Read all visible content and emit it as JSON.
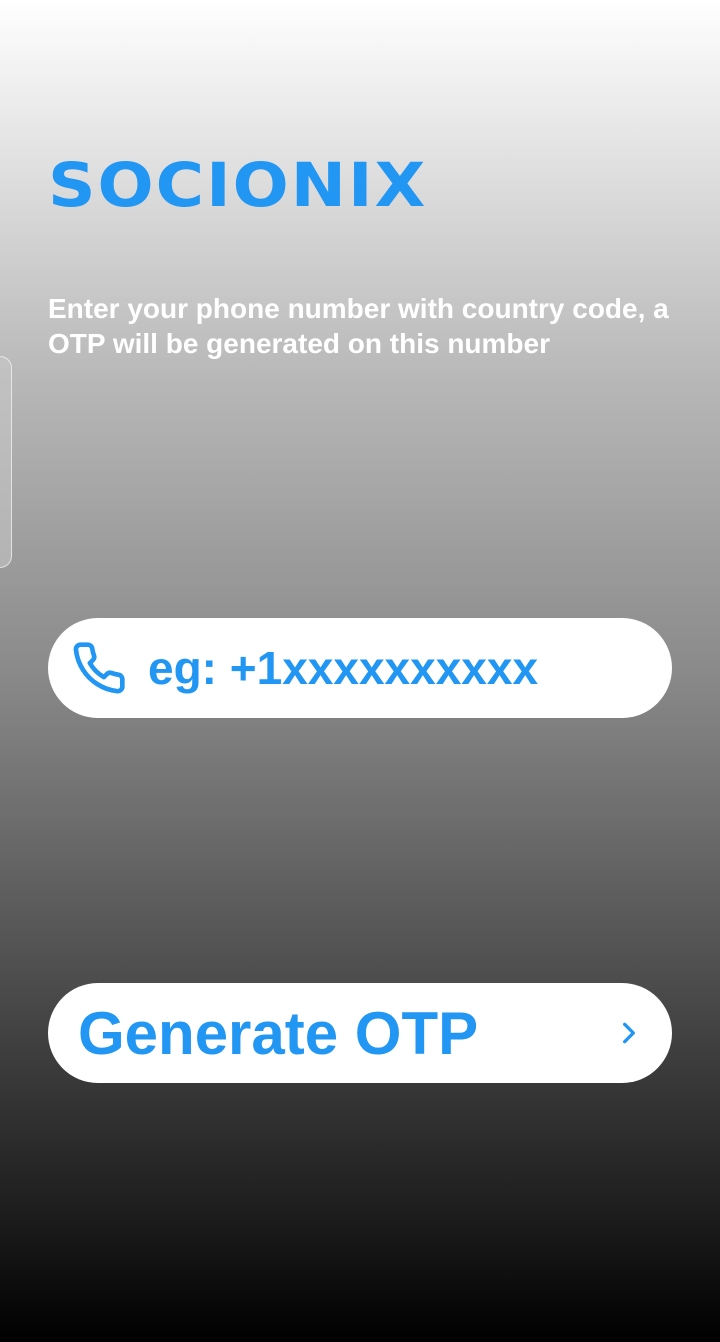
{
  "brand": {
    "name": "SOCIONIX",
    "color": "#2196f3"
  },
  "instructions": {
    "text": "Enter your phone number with country code, a OTP will be generated on this number"
  },
  "phone_field": {
    "icon": "phone-icon",
    "placeholder": "eg: +1xxxxxxxxxx",
    "value": ""
  },
  "generate_button": {
    "label": "Generate OTP",
    "icon": "chevron-right-icon"
  },
  "colors": {
    "accent": "#2196f3",
    "field_background": "#ffffff",
    "text_on_background": "#ffffff"
  }
}
